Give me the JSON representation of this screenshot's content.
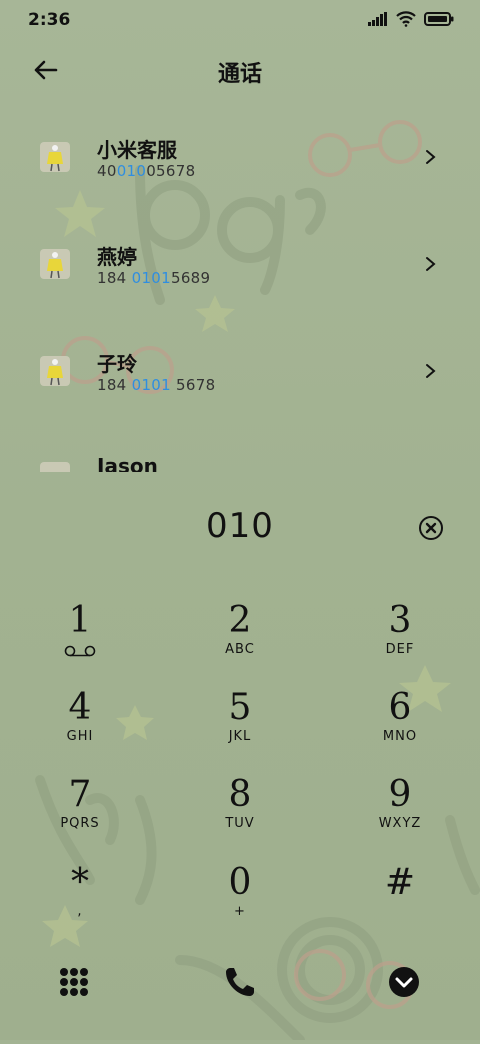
{
  "status": {
    "time": "2:36"
  },
  "header": {
    "title": "通话"
  },
  "contacts": [
    {
      "name": "小米客服",
      "num_pre": "40",
      "num_hl": "010",
      "num_post": "05678"
    },
    {
      "name": "燕婷",
      "num_pre": "184 ",
      "num_hl": "0101",
      "num_post": "5689"
    },
    {
      "name": "子玲",
      "num_pre": "184 ",
      "num_hl": "0101",
      "num_post": " 5678"
    },
    {
      "name": "Jason"
    }
  ],
  "dialer": {
    "input": "010",
    "keys": [
      {
        "digit": "1",
        "letters": "oo"
      },
      {
        "digit": "2",
        "letters": "ABC"
      },
      {
        "digit": "3",
        "letters": "DEF"
      },
      {
        "digit": "4",
        "letters": "GHI"
      },
      {
        "digit": "5",
        "letters": "JKL"
      },
      {
        "digit": "6",
        "letters": "MNO"
      },
      {
        "digit": "7",
        "letters": "PQRS"
      },
      {
        "digit": "8",
        "letters": "TUV"
      },
      {
        "digit": "9",
        "letters": "WXYZ"
      },
      {
        "digit": "*",
        "letters": ","
      },
      {
        "digit": "0",
        "letters": "+"
      },
      {
        "digit": "#",
        "letters": ""
      }
    ]
  },
  "colors": {
    "highlight": "#2f8ee0",
    "background": "#a3b393"
  },
  "icons": {
    "back": "arrow-left-icon",
    "clear": "clear-circle-icon",
    "grid": "grid-icon",
    "call": "phone-icon",
    "collapse": "chevron-down-circle-icon"
  }
}
